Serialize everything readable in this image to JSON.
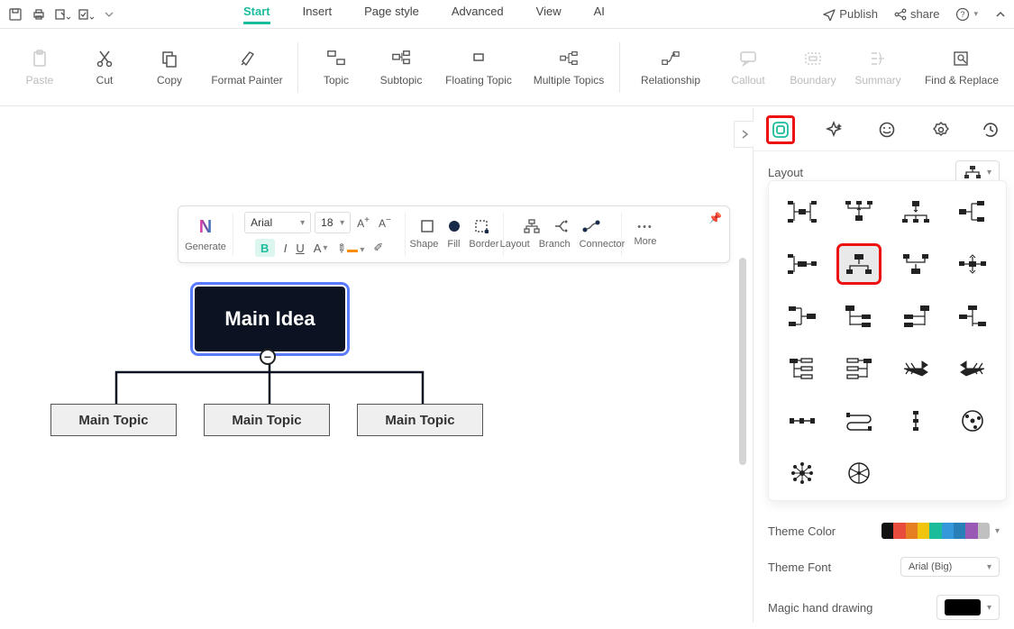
{
  "menu": {
    "start": "Start",
    "insert": "Insert",
    "page_style": "Page style",
    "advanced": "Advanced",
    "view": "View",
    "ai": "AI"
  },
  "top_right": {
    "publish": "Publish",
    "share": "share"
  },
  "ribbon": {
    "paste": "Paste",
    "cut": "Cut",
    "copy": "Copy",
    "format_painter": "Format Painter",
    "topic": "Topic",
    "subtopic": "Subtopic",
    "floating_topic": "Floating Topic",
    "multiple_topics": "Multiple Topics",
    "relationship": "Relationship",
    "callout": "Callout",
    "boundary": "Boundary",
    "summary": "Summary",
    "find_replace": "Find & Replace"
  },
  "fmt": {
    "generate": "Generate",
    "font_name": "Arial",
    "font_size": "18",
    "bold": "B",
    "italic": "I",
    "underline": "U",
    "font_color_letter": "A",
    "shape": "Shape",
    "fill": "Fill",
    "border": "Border",
    "layout": "Layout",
    "branch": "Branch",
    "connector": "Connector",
    "more": "More"
  },
  "mindmap": {
    "main_idea": "Main Idea",
    "collapse_glyph": "−",
    "topic1": "Main Topic",
    "topic2": "Main Topic",
    "topic3": "Main Topic"
  },
  "side": {
    "layout_label": "Layout",
    "theme_color": "Theme Color",
    "theme_font": "Theme Font",
    "theme_font_value": "Arial (Big)",
    "magic_hand": "Magic hand drawing"
  },
  "theme_colors": [
    "#111111",
    "#e74c3c",
    "#e67e22",
    "#f1c40f",
    "#1abc9c",
    "#3498db",
    "#2980b9",
    "#9b59b6",
    "#c0c0c0"
  ]
}
